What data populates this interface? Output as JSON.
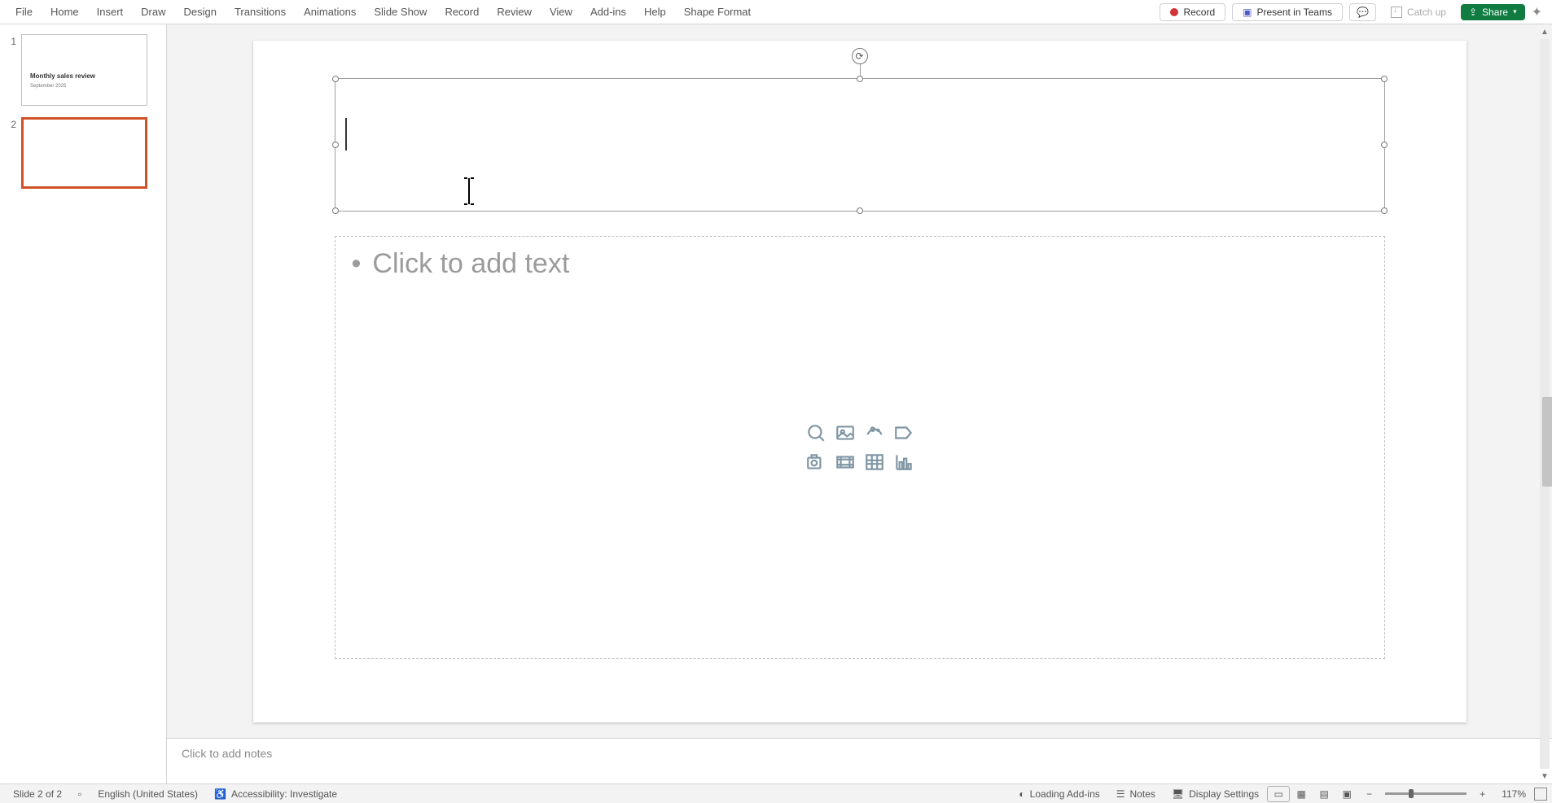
{
  "menu": {
    "tabs": [
      "File",
      "Home",
      "Insert",
      "Draw",
      "Design",
      "Transitions",
      "Animations",
      "Slide Show",
      "Record",
      "Review",
      "View",
      "Add-ins",
      "Help",
      "Shape Format"
    ],
    "record": "Record",
    "present_in_teams": "Present in Teams",
    "catch_up": "Catch up",
    "share": "Share"
  },
  "thumbnails": {
    "slide1_num": "1",
    "slide2_num": "2",
    "slide1_title": "Monthly sales review",
    "slide1_subtitle": "September 2025"
  },
  "slide": {
    "content_placeholder": "Click to add text"
  },
  "notes": {
    "placeholder": "Click to add notes"
  },
  "status": {
    "slide_info": "Slide 2 of 2",
    "language": "English (United States)",
    "accessibility": "Accessibility: Investigate",
    "loading": "Loading Add-ins",
    "notes": "Notes",
    "display_settings": "Display Settings",
    "zoom": "117%"
  }
}
